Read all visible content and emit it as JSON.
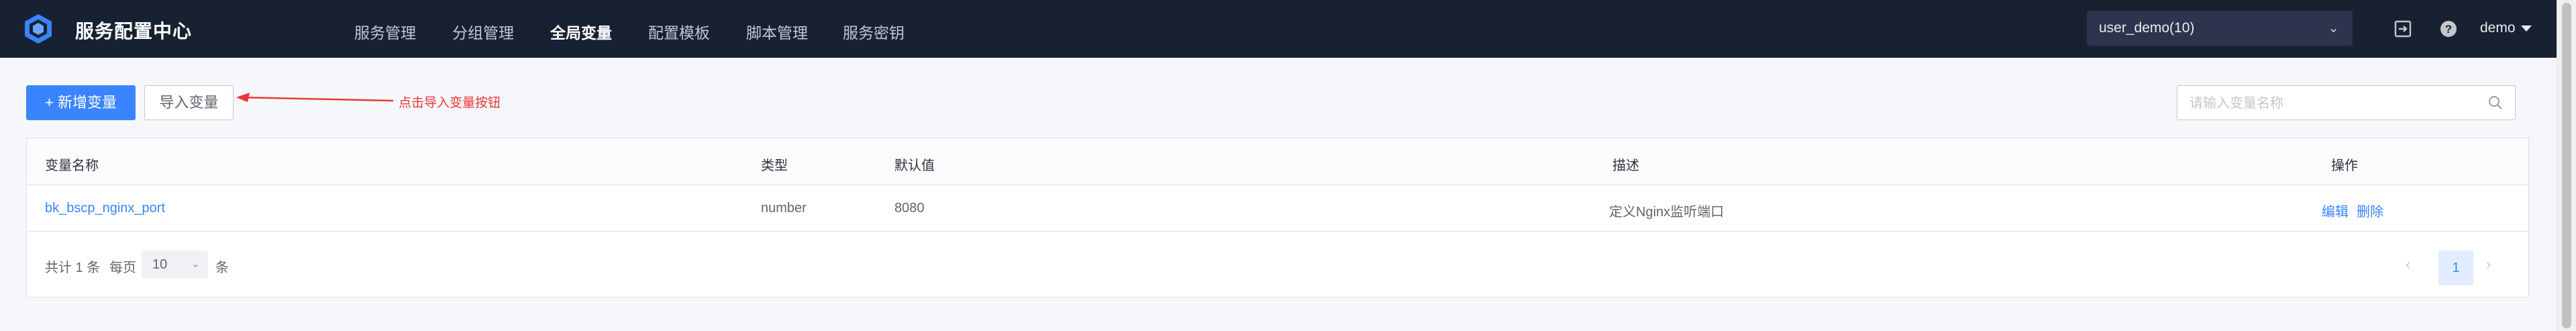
{
  "app": {
    "title": "服务配置中心",
    "logo_icon": "hexagon-cube-logo"
  },
  "nav": {
    "items": [
      {
        "label": "服务管理"
      },
      {
        "label": "分组管理"
      },
      {
        "label": "全局变量",
        "active": true
      },
      {
        "label": "配置模板"
      },
      {
        "label": "脚本管理"
      },
      {
        "label": "服务密钥"
      }
    ]
  },
  "header": {
    "business_select": "user_demo(10)",
    "icons": [
      "export-icon",
      "help-icon"
    ],
    "user": "demo"
  },
  "toolbar": {
    "add_button": "+ 新增变量",
    "import_button": "导入变量",
    "annotation": "点击导入变量按钮",
    "search_placeholder": "请输入变量名称"
  },
  "table": {
    "headers": {
      "name": "变量名称",
      "type": "类型",
      "default": "默认值",
      "desc": "描述",
      "actions": "操作"
    },
    "rows": [
      {
        "name": "bk_bscp_nginx_port",
        "type": "number",
        "default": "8080",
        "desc": "定义Nginx监听端口",
        "edit": "编辑",
        "delete": "删除"
      }
    ]
  },
  "pagination": {
    "total_text": "共计 1 条",
    "per_page_label": "每页",
    "page_size": "10",
    "unit": "条",
    "current_page": "1"
  },
  "colors": {
    "topbar": "#182132",
    "primary": "#3a84ff",
    "annotation": "#ea3636"
  }
}
